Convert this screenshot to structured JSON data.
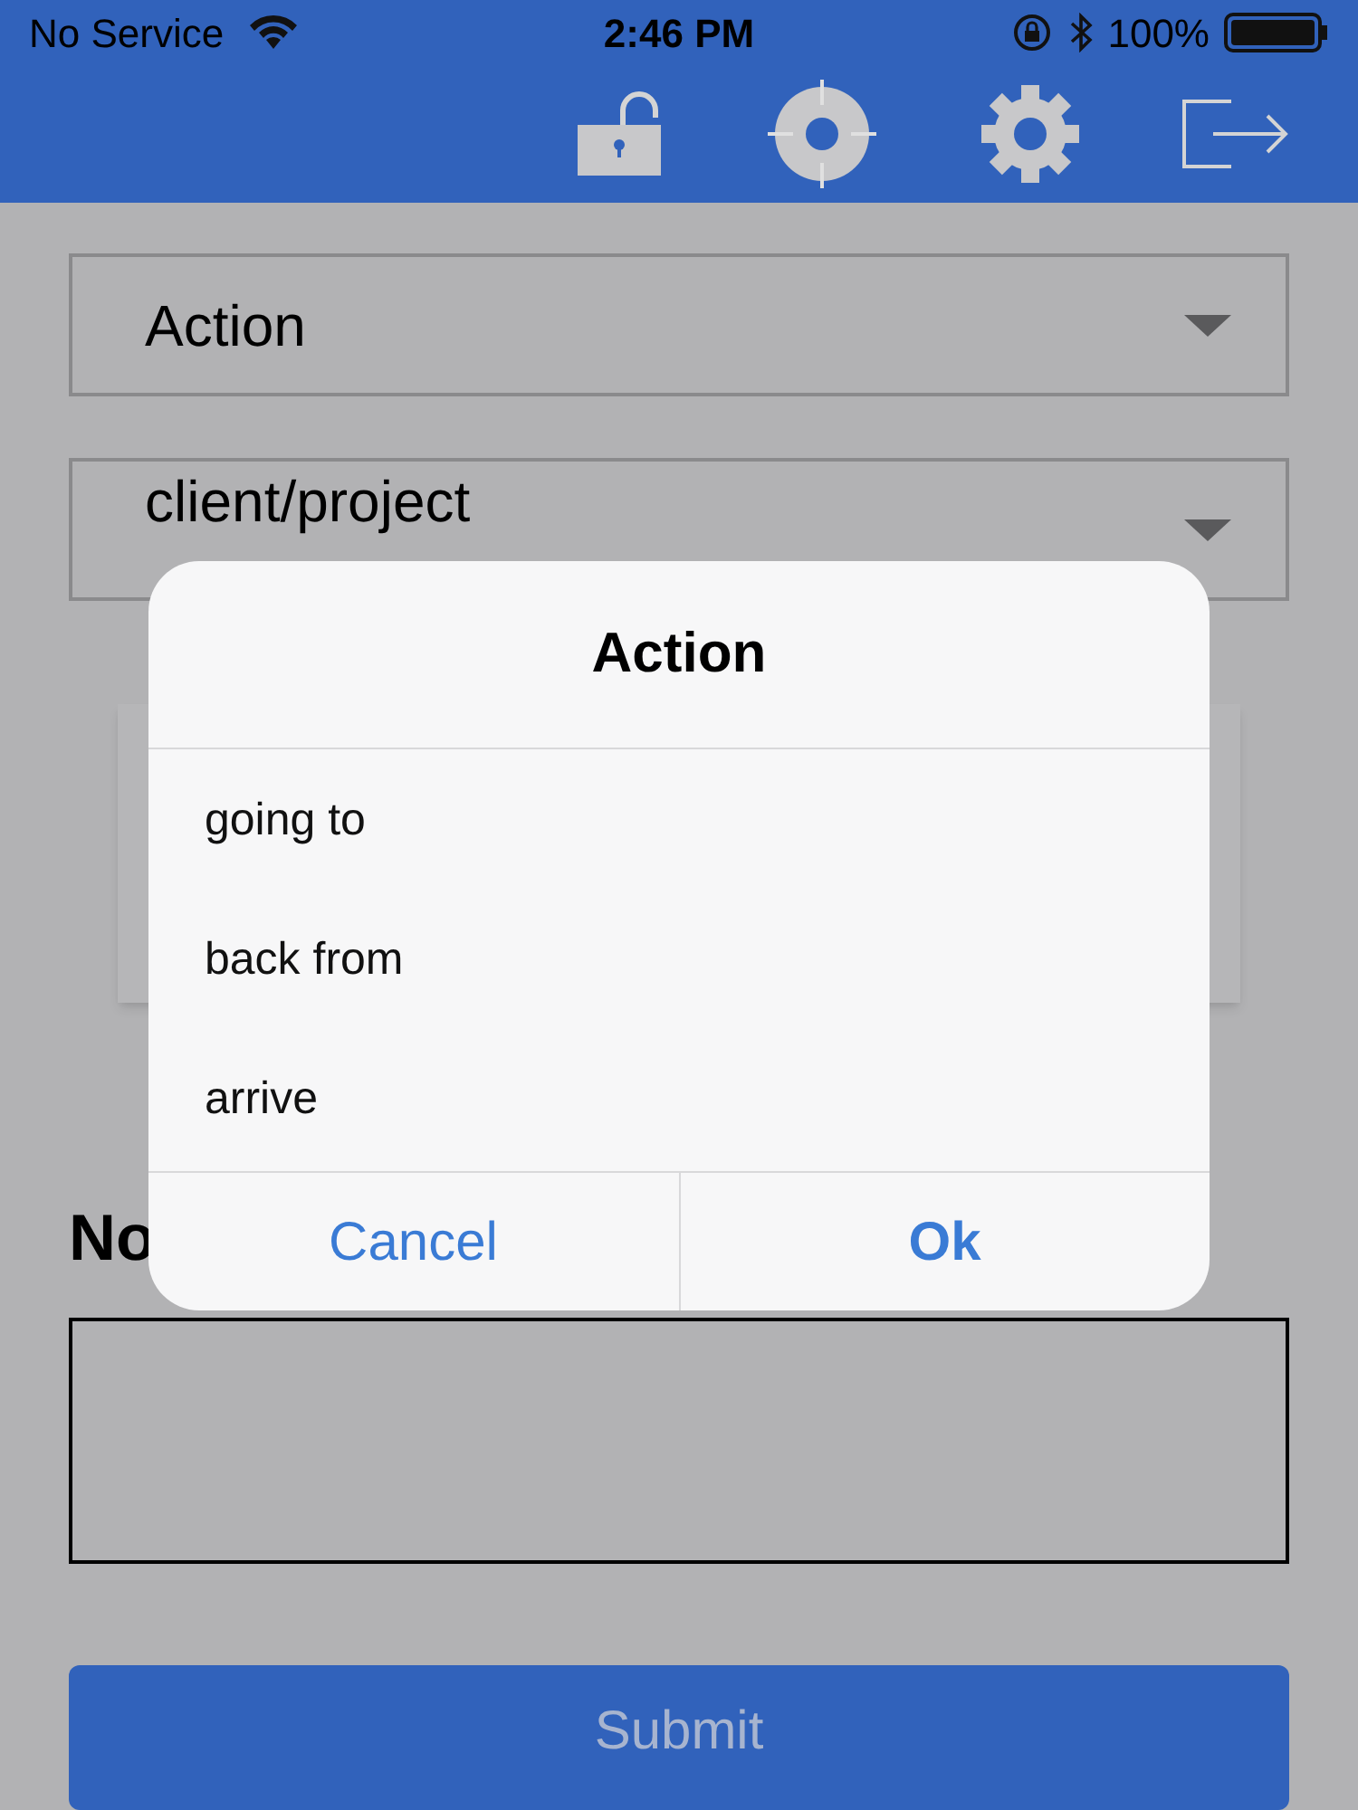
{
  "status_bar": {
    "carrier": "No Service",
    "time": "2:46 PM",
    "battery": "100%"
  },
  "form": {
    "action_select": {
      "value": "Action"
    },
    "client_select": {
      "value": "client/project"
    },
    "notes_label": "No",
    "submit": "Submit"
  },
  "dialog": {
    "title": "Action",
    "options": [
      {
        "label": "going to"
      },
      {
        "label": "back from"
      },
      {
        "label": "arrive"
      }
    ],
    "buttons": [
      {
        "label": "Cancel",
        "kind": "cancel"
      },
      {
        "label": "Ok",
        "kind": "confirm"
      }
    ]
  }
}
